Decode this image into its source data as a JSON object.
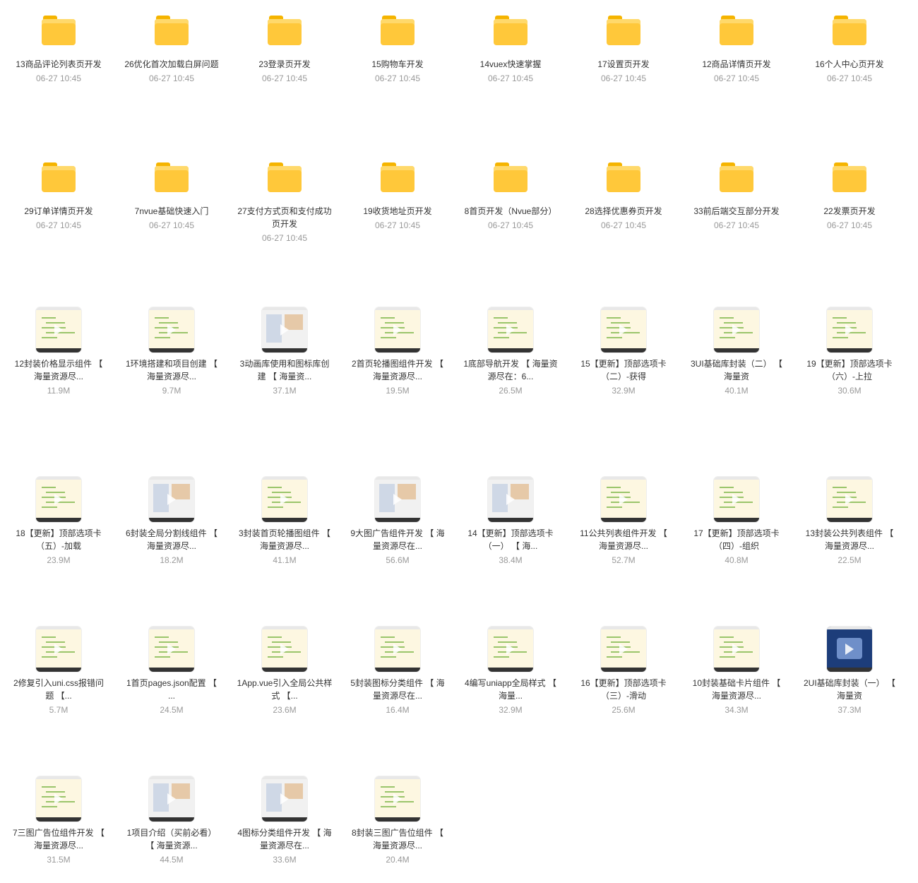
{
  "folders": [
    {
      "name": "13商品评论列表页开发",
      "date": "06-27 10:45"
    },
    {
      "name": "26优化首次加载白屏问题",
      "date": "06-27 10:45"
    },
    {
      "name": "23登录页开发",
      "date": "06-27 10:45"
    },
    {
      "name": "15购物车开发",
      "date": "06-27 10:45"
    },
    {
      "name": "14vuex快速掌握",
      "date": "06-27 10:45"
    },
    {
      "name": "17设置页开发",
      "date": "06-27 10:45"
    },
    {
      "name": "12商品详情页开发",
      "date": "06-27 10:45"
    },
    {
      "name": "16个人中心页开发",
      "date": "06-27 10:45"
    },
    {
      "name": "29订单详情页开发",
      "date": "06-27 10:45"
    },
    {
      "name": "7nvue基础快速入门",
      "date": "06-27 10:45"
    },
    {
      "name": "27支付方式页和支付成功页开发",
      "date": "06-27 10:45"
    },
    {
      "name": "19收货地址页开发",
      "date": "06-27 10:45"
    },
    {
      "name": "8首页开发（Nvue部分）",
      "date": "06-27 10:45"
    },
    {
      "name": "28选择优惠券页开发",
      "date": "06-27 10:45"
    },
    {
      "name": "33前后端交互部分开发",
      "date": "06-27 10:45"
    },
    {
      "name": "22发票页开发",
      "date": "06-27 10:45"
    }
  ],
  "videos": [
    {
      "name": "12封装价格显示组件 【 海量资源尽...",
      "size": "11.9M",
      "thumb": "code"
    },
    {
      "name": "1环境搭建和项目创建 【 海量资源尽...",
      "size": "9.7M",
      "thumb": "code"
    },
    {
      "name": "3动画库使用和图标库创建 【 海量资...",
      "size": "37.1M",
      "thumb": "shot"
    },
    {
      "name": "2首页轮播图组件开发 【 海量资源尽...",
      "size": "19.5M",
      "thumb": "code"
    },
    {
      "name": "1底部导航开发 【 海量资源尽在：6...",
      "size": "26.5M",
      "thumb": "code"
    },
    {
      "name": "15【更新】顶部选项卡（二）-获得",
      "size": "32.9M",
      "thumb": "code"
    },
    {
      "name": "3UI基础库封装（二） 【 海量资",
      "size": "40.1M",
      "thumb": "code"
    },
    {
      "name": "19【更新】顶部选项卡（六）-上拉",
      "size": "30.6M",
      "thumb": "code"
    },
    {
      "name": "18【更新】顶部选项卡（五）-加载",
      "size": "23.9M",
      "thumb": "code"
    },
    {
      "name": "6封装全局分割线组件 【 海量资源尽...",
      "size": "18.2M",
      "thumb": "shot"
    },
    {
      "name": "3封装首页轮播图组件 【 海量资源尽...",
      "size": "41.1M",
      "thumb": "code"
    },
    {
      "name": "9大图广告组件开发 【 海量资源尽在...",
      "size": "56.6M",
      "thumb": "shot"
    },
    {
      "name": "14【更新】顶部选项卡（一） 【 海...",
      "size": "38.4M",
      "thumb": "shot"
    },
    {
      "name": "11公共列表组件开发 【 海量资源尽...",
      "size": "52.7M",
      "thumb": "code"
    },
    {
      "name": "17【更新】顶部选项卡（四）-组织",
      "size": "40.8M",
      "thumb": "code"
    },
    {
      "name": "13封装公共列表组件 【 海量资源尽...",
      "size": "22.5M",
      "thumb": "code"
    },
    {
      "name": "2修复引入uni.css报错问题 【...",
      "size": "5.7M",
      "thumb": "code"
    },
    {
      "name": "1首页pages.json配置 【 ...",
      "size": "24.5M",
      "thumb": "code"
    },
    {
      "name": "1App.vue引入全局公共样式 【...",
      "size": "23.6M",
      "thumb": "code"
    },
    {
      "name": "5封装图标分类组件 【 海量资源尽在...",
      "size": "16.4M",
      "thumb": "code"
    },
    {
      "name": "4编写uniapp全局样式 【 海量...",
      "size": "32.9M",
      "thumb": "code"
    },
    {
      "name": "16【更新】顶部选项卡（三）-滑动",
      "size": "25.6M",
      "thumb": "code"
    },
    {
      "name": "10封装基础卡片组件 【 海量资源尽...",
      "size": "34.3M",
      "thumb": "code"
    },
    {
      "name": "2UI基础库封装（一） 【 海量资",
      "size": "37.3M",
      "thumb": "dark"
    },
    {
      "name": "7三图广告位组件开发 【 海量资源尽...",
      "size": "31.5M",
      "thumb": "code"
    },
    {
      "name": "1项目介绍（买前必看） 【 海量资源...",
      "size": "44.5M",
      "thumb": "shot"
    },
    {
      "name": "4图标分类组件开发 【 海量资源尽在...",
      "size": "33.6M",
      "thumb": "shot"
    },
    {
      "name": "8封装三图广告位组件 【 海量资源尽...",
      "size": "20.4M",
      "thumb": "code"
    }
  ],
  "colors": {
    "folder": "#ffc83a",
    "meta": "#999999",
    "text": "#333333"
  }
}
